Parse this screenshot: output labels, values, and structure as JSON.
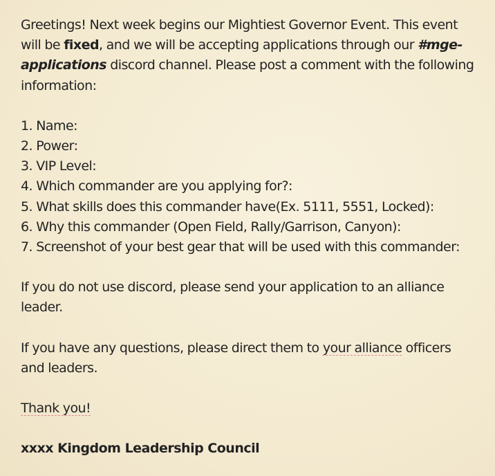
{
  "intro": {
    "greeting": "Greetings! Next week begins our Mightiest Governor Event. This event will be ",
    "fixed_word": "fixed",
    "after_fixed": ", and we will be accepting applications through our ",
    "channel": "#mge-applications",
    "after_channel": " discord channel. Please post a comment with the following information:"
  },
  "form_items": [
    {
      "number": "1.",
      "text": "Name:"
    },
    {
      "number": "2.",
      "text": "Power:"
    },
    {
      "number": "3.",
      "text": "VIP Level:"
    },
    {
      "number": "4.",
      "text": "Which commander are you applying for?:"
    },
    {
      "number": "5.",
      "text": "What skills does this commander have(Ex. 5111, 5551, Locked):"
    },
    {
      "number": "6.",
      "text": "Why this commander (Open Field, Rally/Garrison, Canyon):"
    },
    {
      "number": "7.",
      "text": "Screenshot of your best gear that will be used with this commander:"
    }
  ],
  "no_discord": "If you do not use discord, please send your application to an alliance leader.",
  "questions": {
    "before": "If you have any questions, please direct them to ",
    "highlight": "your alliance",
    "after": " officers and leaders."
  },
  "thanks": "Thank you!",
  "signature": "xxxx Kingdom Leadership Council"
}
